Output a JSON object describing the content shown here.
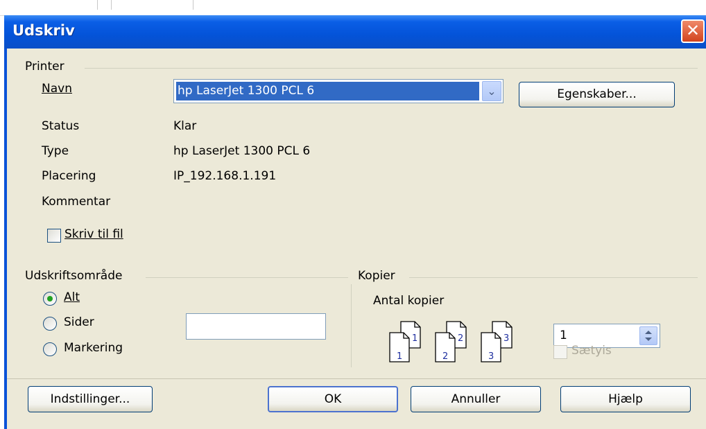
{
  "window": {
    "title": "Udskriv"
  },
  "printer": {
    "group_label": "Printer",
    "name_label": "Navn",
    "name_value": "hp LaserJet 1300 PCL 6",
    "properties_button": "Egenskaber...",
    "status_label": "Status",
    "status_value": "Klar",
    "type_label": "Type",
    "type_value": "hp LaserJet 1300 PCL 6",
    "location_label": "Placering",
    "location_value": "IP_192.168.1.191",
    "comment_label": "Kommentar",
    "comment_value": "",
    "print_to_file_label": "Skriv til fil",
    "print_to_file_checked": false
  },
  "print_range": {
    "group_label": "Udskriftsområde",
    "options": [
      {
        "label": "Alt",
        "selected": true
      },
      {
        "label": "Sider",
        "selected": false
      },
      {
        "label": "Markering",
        "selected": false
      }
    ],
    "pages_value": ""
  },
  "copies": {
    "group_label": "Kopier",
    "count_label": "Antal kopier",
    "count_value": "1",
    "collate_label": "Sætyis",
    "collate_checked": false,
    "collate_enabled": false,
    "page_numbers": [
      "1",
      "1",
      "2",
      "2",
      "3",
      "3"
    ]
  },
  "buttons": {
    "options": "Indstillinger...",
    "ok": "OK",
    "cancel": "Annuller",
    "help": "Hjælp"
  },
  "icons": {
    "close": "close-icon",
    "dropdown": "chevron-down-icon",
    "spinner": "spin-arrows-icon"
  },
  "colors": {
    "title_bar": "#0453d8",
    "dialog_bg": "#ece9d8",
    "selection": "#316ac5",
    "close_button": "#d2431d"
  }
}
